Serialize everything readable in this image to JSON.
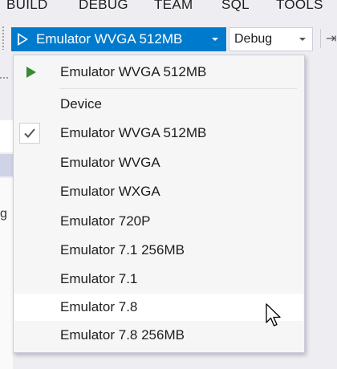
{
  "menubar": {
    "items": [
      "BUILD",
      "DEBUG",
      "TEAM",
      "SQL",
      "TOOLS"
    ]
  },
  "toolbar": {
    "device_label": "Emulator WVGA 512MB",
    "config_label": "Debug"
  },
  "dropdown": {
    "top_item": "Emulator WVGA 512MB",
    "section_header": "Device",
    "items": [
      "Emulator WVGA 512MB",
      "Emulator WVGA",
      "Emulator WXGA",
      "Emulator 720P",
      "Emulator 7.1 256MB",
      "Emulator 7.1",
      "Emulator 7.8",
      "Emulator 7.8 256MB"
    ],
    "checked_item": "Emulator WVGA 512MB",
    "hovered_item": "Emulator 7.8"
  },
  "colors": {
    "accent": "#007acc",
    "run_green": "#388a34",
    "menu_bg": "#f6f6f6",
    "hover_bg": "#ffffff"
  },
  "icons": {
    "run": "play-icon",
    "checked": "check-icon",
    "dropdown": "chevron-down-icon",
    "cursor": "mouse-pointer-icon"
  }
}
